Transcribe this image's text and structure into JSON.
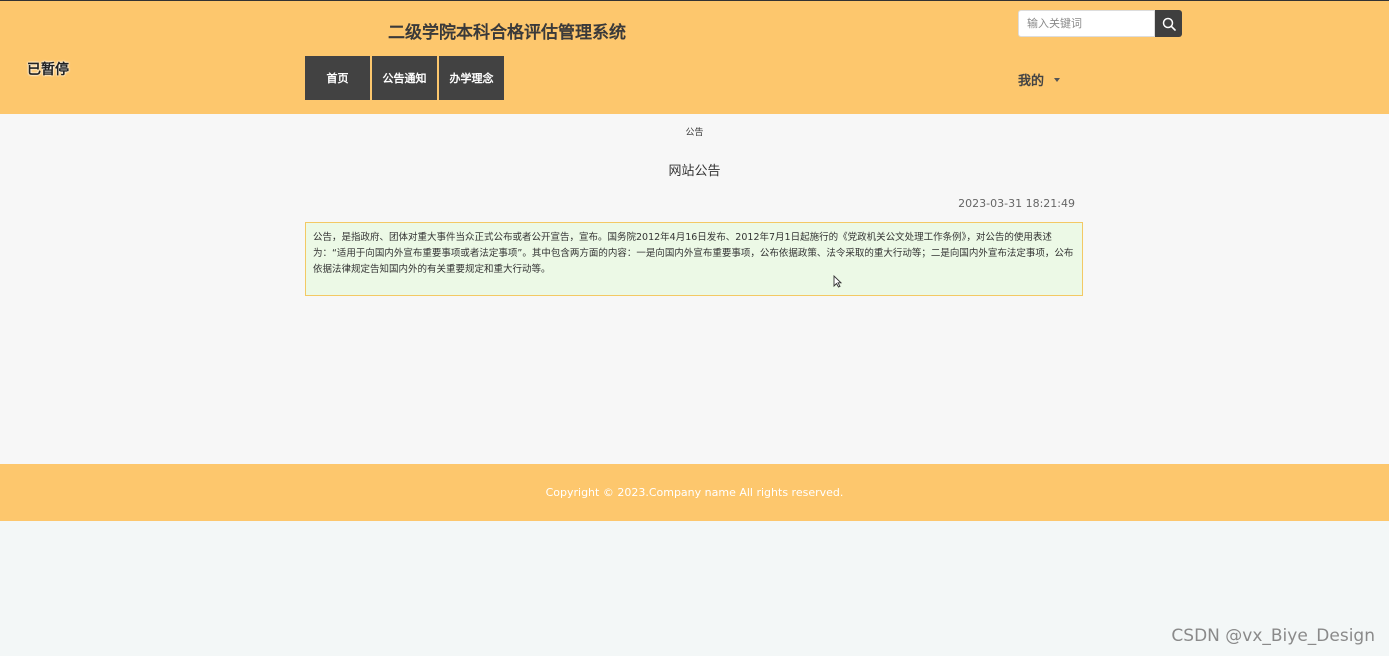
{
  "overlay": {
    "paused": "已暂停"
  },
  "header": {
    "title": "二级学院本科合格评估管理系统",
    "search": {
      "placeholder": "输入关键词",
      "icon": "search-icon"
    },
    "nav": [
      {
        "label": "首页"
      },
      {
        "label": "公告通知"
      },
      {
        "label": "办学理念"
      }
    ],
    "user_menu": {
      "label": "我的",
      "icon": "caret-down-icon"
    }
  },
  "main": {
    "breadcrumb": "公告",
    "notice_title": "网站公告",
    "notice_time": "2023-03-31 18:21:49",
    "notice_content": "公告，是指政府、团体对重大事件当众正式公布或者公开宣告，宣布。国务院2012年4月16日发布、2012年7月1日起施行的《党政机关公文处理工作条例》，对公告的使用表述为：“适用于向国内外宣布重要事项或者法定事项”。其中包含两方面的内容：一是向国内外宣布重要事项，公布依据政策、法令采取的重大行动等；二是向国内外宣布法定事项，公布依据法律规定告知国内外的有关重要规定和重大行动等。"
  },
  "footer": {
    "copyright": "Copyright © 2023.Company name All rights reserved."
  },
  "watermark": "CSDN @vx_Biye_Design",
  "colors": {
    "header_bg": "#fdc76d",
    "nav_bg": "#424242",
    "notice_bg": "#ecf9e6",
    "notice_border": "#f3c964"
  }
}
